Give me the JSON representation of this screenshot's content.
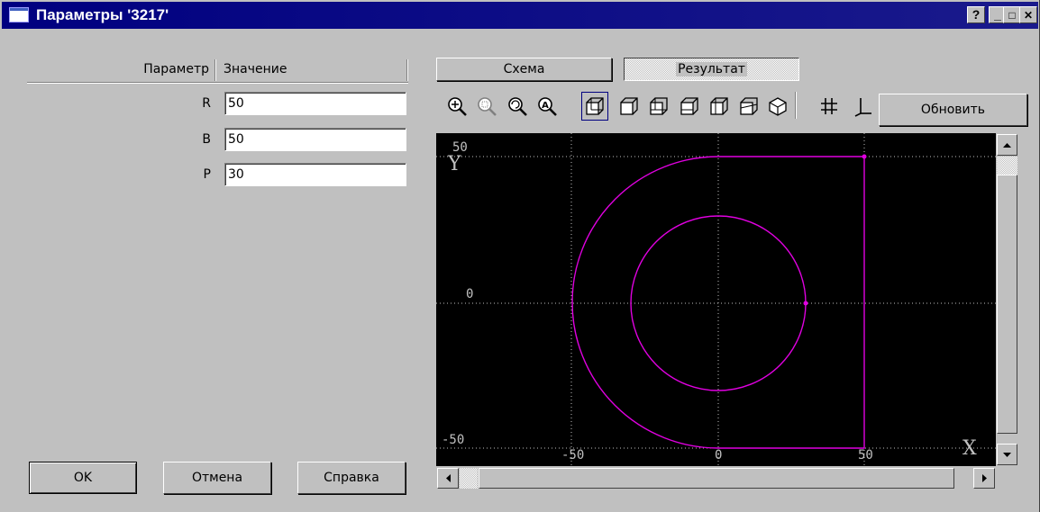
{
  "window": {
    "title": "Параметры '3217'",
    "help_glyph": "?",
    "minimize_glyph": "_",
    "maximize_glyph": "□",
    "close_glyph": "✕"
  },
  "params": {
    "col_param": "Параметр",
    "col_value": "Значение",
    "rows": [
      {
        "name": "R",
        "value": "50"
      },
      {
        "name": "B",
        "value": "50"
      },
      {
        "name": "P",
        "value": "30"
      }
    ]
  },
  "buttons": {
    "ok": "OK",
    "cancel": "Отмена",
    "help": "Справка"
  },
  "tabs": {
    "schema": "Схема",
    "result": "Результат",
    "active": "Результат"
  },
  "toolbar": {
    "icons": [
      "zoom-in-icon",
      "zoom-window-icon",
      "zoom-rotate-icon",
      "zoom-all-icon",
      "view-front-icon",
      "view-iso1-icon",
      "view-iso2-icon",
      "view-iso3-icon",
      "view-iso4-icon",
      "view-iso5-icon",
      "view-3d-icon",
      "grid-icon",
      "axes-icon"
    ],
    "refresh": "Обновить"
  },
  "plot": {
    "x_axis_label": "X",
    "y_axis_label": "Y",
    "x_ticks": [
      "-50",
      "0",
      "50"
    ],
    "y_ticks": [
      "50",
      "0",
      "-50"
    ],
    "xlim": [
      -50,
      50
    ],
    "ylim": [
      -50,
      50
    ],
    "background": "#000000",
    "shape_color": "#e000e0",
    "grid_color": "#c0c0c0"
  },
  "chart_data": {
    "type": "line",
    "xlim": [
      -50,
      50
    ],
    "ylim": [
      -50,
      50
    ],
    "grid": true,
    "series": [
      {
        "x": [
          0,
          50,
          50,
          0
        ],
        "y": [
          50,
          50,
          -50,
          -50
        ],
        "arc": "left semicircle radius 50 centered at (0,0)"
      },
      {
        "circle": {
          "cx": 0,
          "cy": 0,
          "r": 30
        }
      }
    ],
    "points": [
      [
        50,
        50
      ],
      [
        30,
        0
      ]
    ]
  }
}
